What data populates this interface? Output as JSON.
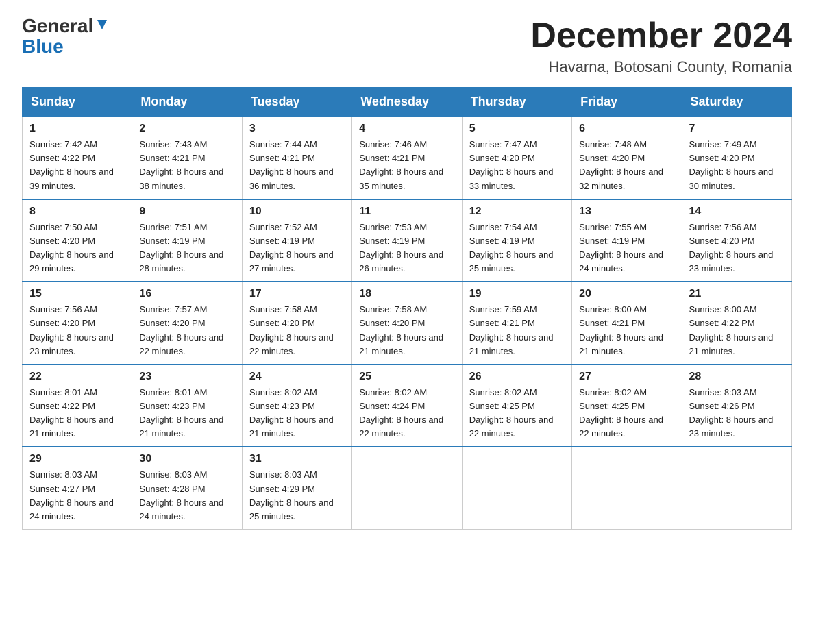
{
  "header": {
    "logo_general": "General",
    "logo_blue": "Blue",
    "month_title": "December 2024",
    "location": "Havarna, Botosani County, Romania"
  },
  "weekdays": [
    "Sunday",
    "Monday",
    "Tuesday",
    "Wednesday",
    "Thursday",
    "Friday",
    "Saturday"
  ],
  "weeks": [
    [
      {
        "day": "1",
        "sunrise": "7:42 AM",
        "sunset": "4:22 PM",
        "daylight": "8 hours and 39 minutes."
      },
      {
        "day": "2",
        "sunrise": "7:43 AM",
        "sunset": "4:21 PM",
        "daylight": "8 hours and 38 minutes."
      },
      {
        "day": "3",
        "sunrise": "7:44 AM",
        "sunset": "4:21 PM",
        "daylight": "8 hours and 36 minutes."
      },
      {
        "day": "4",
        "sunrise": "7:46 AM",
        "sunset": "4:21 PM",
        "daylight": "8 hours and 35 minutes."
      },
      {
        "day": "5",
        "sunrise": "7:47 AM",
        "sunset": "4:20 PM",
        "daylight": "8 hours and 33 minutes."
      },
      {
        "day": "6",
        "sunrise": "7:48 AM",
        "sunset": "4:20 PM",
        "daylight": "8 hours and 32 minutes."
      },
      {
        "day": "7",
        "sunrise": "7:49 AM",
        "sunset": "4:20 PM",
        "daylight": "8 hours and 30 minutes."
      }
    ],
    [
      {
        "day": "8",
        "sunrise": "7:50 AM",
        "sunset": "4:20 PM",
        "daylight": "8 hours and 29 minutes."
      },
      {
        "day": "9",
        "sunrise": "7:51 AM",
        "sunset": "4:19 PM",
        "daylight": "8 hours and 28 minutes."
      },
      {
        "day": "10",
        "sunrise": "7:52 AM",
        "sunset": "4:19 PM",
        "daylight": "8 hours and 27 minutes."
      },
      {
        "day": "11",
        "sunrise": "7:53 AM",
        "sunset": "4:19 PM",
        "daylight": "8 hours and 26 minutes."
      },
      {
        "day": "12",
        "sunrise": "7:54 AM",
        "sunset": "4:19 PM",
        "daylight": "8 hours and 25 minutes."
      },
      {
        "day": "13",
        "sunrise": "7:55 AM",
        "sunset": "4:19 PM",
        "daylight": "8 hours and 24 minutes."
      },
      {
        "day": "14",
        "sunrise": "7:56 AM",
        "sunset": "4:20 PM",
        "daylight": "8 hours and 23 minutes."
      }
    ],
    [
      {
        "day": "15",
        "sunrise": "7:56 AM",
        "sunset": "4:20 PM",
        "daylight": "8 hours and 23 minutes."
      },
      {
        "day": "16",
        "sunrise": "7:57 AM",
        "sunset": "4:20 PM",
        "daylight": "8 hours and 22 minutes."
      },
      {
        "day": "17",
        "sunrise": "7:58 AM",
        "sunset": "4:20 PM",
        "daylight": "8 hours and 22 minutes."
      },
      {
        "day": "18",
        "sunrise": "7:58 AM",
        "sunset": "4:20 PM",
        "daylight": "8 hours and 21 minutes."
      },
      {
        "day": "19",
        "sunrise": "7:59 AM",
        "sunset": "4:21 PM",
        "daylight": "8 hours and 21 minutes."
      },
      {
        "day": "20",
        "sunrise": "8:00 AM",
        "sunset": "4:21 PM",
        "daylight": "8 hours and 21 minutes."
      },
      {
        "day": "21",
        "sunrise": "8:00 AM",
        "sunset": "4:22 PM",
        "daylight": "8 hours and 21 minutes."
      }
    ],
    [
      {
        "day": "22",
        "sunrise": "8:01 AM",
        "sunset": "4:22 PM",
        "daylight": "8 hours and 21 minutes."
      },
      {
        "day": "23",
        "sunrise": "8:01 AM",
        "sunset": "4:23 PM",
        "daylight": "8 hours and 21 minutes."
      },
      {
        "day": "24",
        "sunrise": "8:02 AM",
        "sunset": "4:23 PM",
        "daylight": "8 hours and 21 minutes."
      },
      {
        "day": "25",
        "sunrise": "8:02 AM",
        "sunset": "4:24 PM",
        "daylight": "8 hours and 22 minutes."
      },
      {
        "day": "26",
        "sunrise": "8:02 AM",
        "sunset": "4:25 PM",
        "daylight": "8 hours and 22 minutes."
      },
      {
        "day": "27",
        "sunrise": "8:02 AM",
        "sunset": "4:25 PM",
        "daylight": "8 hours and 22 minutes."
      },
      {
        "day": "28",
        "sunrise": "8:03 AM",
        "sunset": "4:26 PM",
        "daylight": "8 hours and 23 minutes."
      }
    ],
    [
      {
        "day": "29",
        "sunrise": "8:03 AM",
        "sunset": "4:27 PM",
        "daylight": "8 hours and 24 minutes."
      },
      {
        "day": "30",
        "sunrise": "8:03 AM",
        "sunset": "4:28 PM",
        "daylight": "8 hours and 24 minutes."
      },
      {
        "day": "31",
        "sunrise": "8:03 AM",
        "sunset": "4:29 PM",
        "daylight": "8 hours and 25 minutes."
      },
      null,
      null,
      null,
      null
    ]
  ]
}
